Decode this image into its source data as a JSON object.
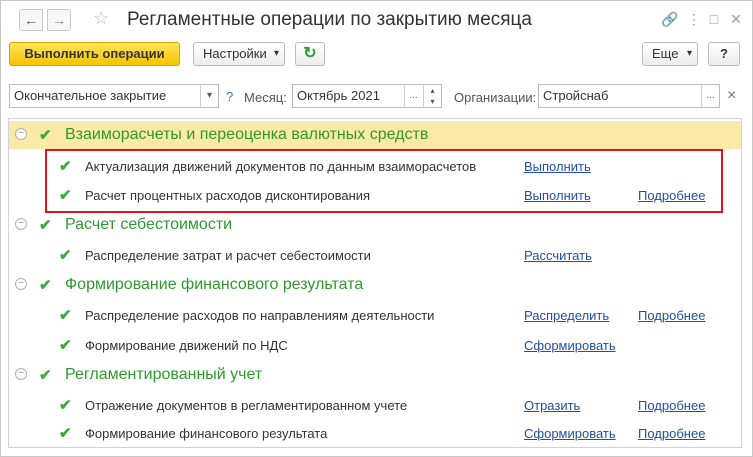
{
  "window": {
    "title": "Регламентные операции по закрытию месяца",
    "nav_back": "←",
    "nav_forward": "→",
    "star": "☆",
    "icons": {
      "link": "🔗",
      "menu": "⋮",
      "maximize": "□",
      "close": "×"
    }
  },
  "toolbar": {
    "execute_label": "Выполнить операции",
    "settings_label": "Настройки",
    "settings_arrow": "▾",
    "refresh_glyph": "↻",
    "more_label": "Еще",
    "more_arrow": "▾",
    "help_label": "?"
  },
  "filters": {
    "mode_value": "Окончательное закрытие",
    "mode_arrow": "▾",
    "help_label": "?",
    "month_label": "Месяц:",
    "month_value": "Октябрь 2021",
    "ellipsis": "...",
    "spin_up": "▴",
    "spin_down": "▾",
    "org_label": "Организации:",
    "org_value": "Стройснаб",
    "org_ellipsis": "...",
    "org_clear": "×"
  },
  "list": {
    "collapse_glyph": "⊖",
    "check_glyph": "✔",
    "groups": [
      {
        "title": "Взаиморасчеты и переоценка валютных средств",
        "items": [
          {
            "text": "Актуализация движений документов по данным взаиморасчетов",
            "action": "Выполнить",
            "details": ""
          },
          {
            "text": "Расчет процентных расходов дисконтирования",
            "action": "Выполнить",
            "details": "Подробнее"
          }
        ]
      },
      {
        "title": "Расчет себестоимости",
        "items": [
          {
            "text": "Распределение затрат и расчет себестоимости",
            "action": "Рассчитать",
            "details": ""
          }
        ]
      },
      {
        "title": "Формирование финансового результата",
        "items": [
          {
            "text": "Распределение расходов по направлениям деятельности",
            "action": "Распределить",
            "details": "Подробнее"
          },
          {
            "text": "Формирование движений по НДС",
            "action": "Сформировать",
            "details": ""
          }
        ]
      },
      {
        "title": "Регламентированный учет",
        "items": [
          {
            "text": "Отражение документов в регламентированном учете",
            "action": "Отразить",
            "details": "Подробнее"
          },
          {
            "text": "Формирование финансового результата",
            "action": "Сформировать",
            "details": "Подробнее"
          }
        ]
      }
    ]
  },
  "colors": {
    "accent_yellow": "#f5c400",
    "group_green": "#2e9a2e",
    "check_green": "#3aaa3a",
    "link_blue": "#1f4fa8",
    "highlight_red": "#e0141e",
    "selected_row": "#fbe9a8"
  }
}
